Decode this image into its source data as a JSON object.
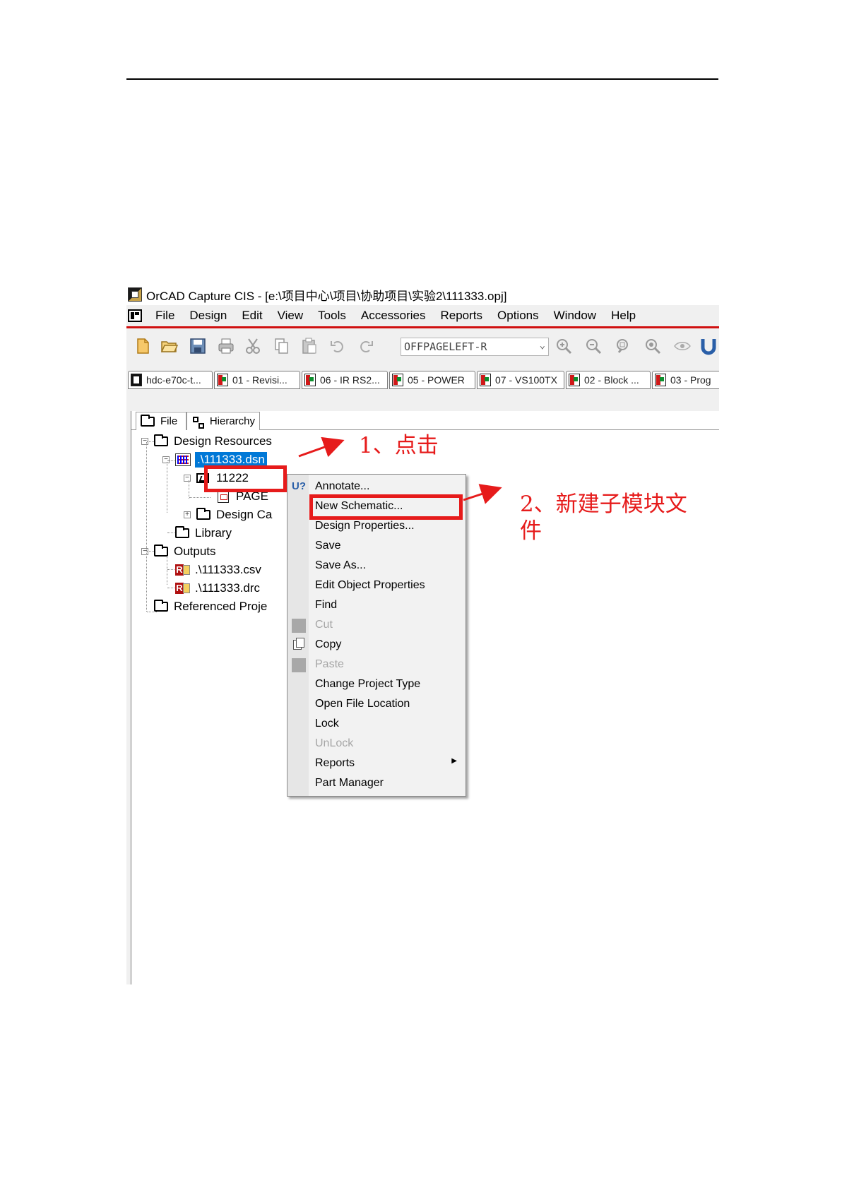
{
  "window": {
    "title": "OrCAD Capture CIS - [e:\\项目中心\\项目\\协助项目\\实验2\\111333.opj]"
  },
  "menubar": {
    "items": [
      "File",
      "Design",
      "Edit",
      "View",
      "Tools",
      "Accessories",
      "Reports",
      "Options",
      "Window",
      "Help"
    ]
  },
  "toolbar": {
    "combo_value": "OFFPAGELEFT-R",
    "icons": [
      "new-file-icon",
      "open-folder-icon",
      "save-icon",
      "print-icon",
      "cut-icon",
      "copy-icon",
      "paste-icon",
      "undo-icon",
      "redo-icon",
      "zoom-in-icon",
      "zoom-out-icon",
      "zoom-area-icon",
      "zoom-all-icon",
      "eye-icon",
      "u-icon"
    ]
  },
  "doc_tabs": [
    {
      "label": "hdc-e70c-t..."
    },
    {
      "label": "01 - Revisi..."
    },
    {
      "label": "06 - IR RS2..."
    },
    {
      "label": "05 - POWER"
    },
    {
      "label": "07 - VS100TX"
    },
    {
      "label": "02 - Block ..."
    },
    {
      "label": "03 - Prog"
    }
  ],
  "pane_tabs": {
    "file": "File",
    "hierarchy": "Hierarchy"
  },
  "tree": {
    "design_resources": "Design Resources",
    "dsn": ".\\111333.dsn",
    "schematic_folder": "11222",
    "page": "PAGE",
    "design_cache": "Design Ca",
    "library": "Library",
    "outputs": "Outputs",
    "csv": ".\\111333.csv",
    "drc": ".\\111333.drc",
    "referenced_projects": "Referenced Proje"
  },
  "context_menu": {
    "items": [
      {
        "label": "Annotate...",
        "enabled": true
      },
      {
        "label": "New Schematic...",
        "enabled": true
      },
      {
        "label": "Design Properties...",
        "enabled": true
      },
      {
        "label": "Save",
        "enabled": true
      },
      {
        "label": "Save As...",
        "enabled": true
      },
      {
        "label": "Edit Object Properties",
        "enabled": true
      },
      {
        "label": "Find",
        "enabled": true
      },
      {
        "label": "Cut",
        "enabled": false
      },
      {
        "label": "Copy",
        "enabled": true
      },
      {
        "label": "Paste",
        "enabled": false
      },
      {
        "label": "Change Project Type",
        "enabled": true
      },
      {
        "label": "Open File Location",
        "enabled": true
      },
      {
        "label": "Lock",
        "enabled": true
      },
      {
        "label": "UnLock",
        "enabled": false
      },
      {
        "label": "Reports",
        "enabled": true
      },
      {
        "label": "Part Manager",
        "enabled": true
      }
    ]
  },
  "annotations": {
    "step1": "1、点击",
    "step2_line1": "2、新建子模块文",
    "step2_line2": "件",
    "color": "#e61b1b"
  }
}
